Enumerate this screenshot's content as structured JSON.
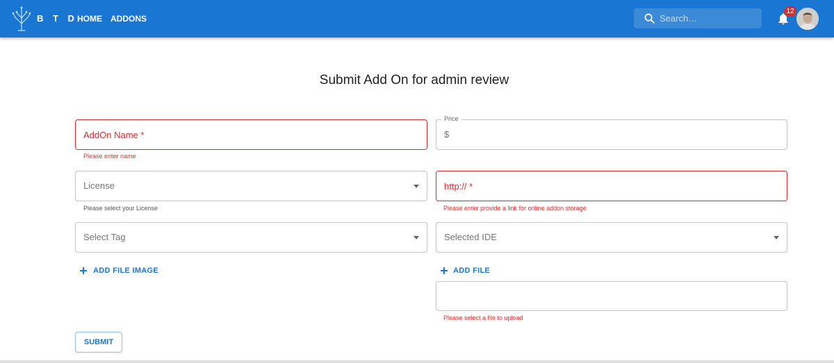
{
  "header": {
    "logo_text": "B T D",
    "nav": [
      {
        "label": "HOME"
      },
      {
        "label": "ADDONS"
      }
    ],
    "search_placeholder": "Search…",
    "notification_count": "12",
    "colors": {
      "appbar": "#1976d2",
      "badge": "#d32f2f"
    }
  },
  "form": {
    "title": "Submit Add On for admin review",
    "addon_name": {
      "placeholder": "AddOn Name *",
      "error": "Please enter name"
    },
    "price": {
      "label": "Price",
      "adornment": "$"
    },
    "license": {
      "label": "License",
      "helper": "Please select your License"
    },
    "link": {
      "placeholder": "http:// *",
      "error": "Please enter provide a link for online addon storage"
    },
    "tag": {
      "label": "Select Tag"
    },
    "ide": {
      "label": "Selected IDE"
    },
    "add_file_image_label": "ADD FILE IMAGE",
    "add_file_label": "ADD FILE",
    "file_error": "Please select a file to upload",
    "submit_label": "SUBMIT",
    "colors": {
      "error": "#d32f2f",
      "primary": "#1976d2"
    }
  }
}
